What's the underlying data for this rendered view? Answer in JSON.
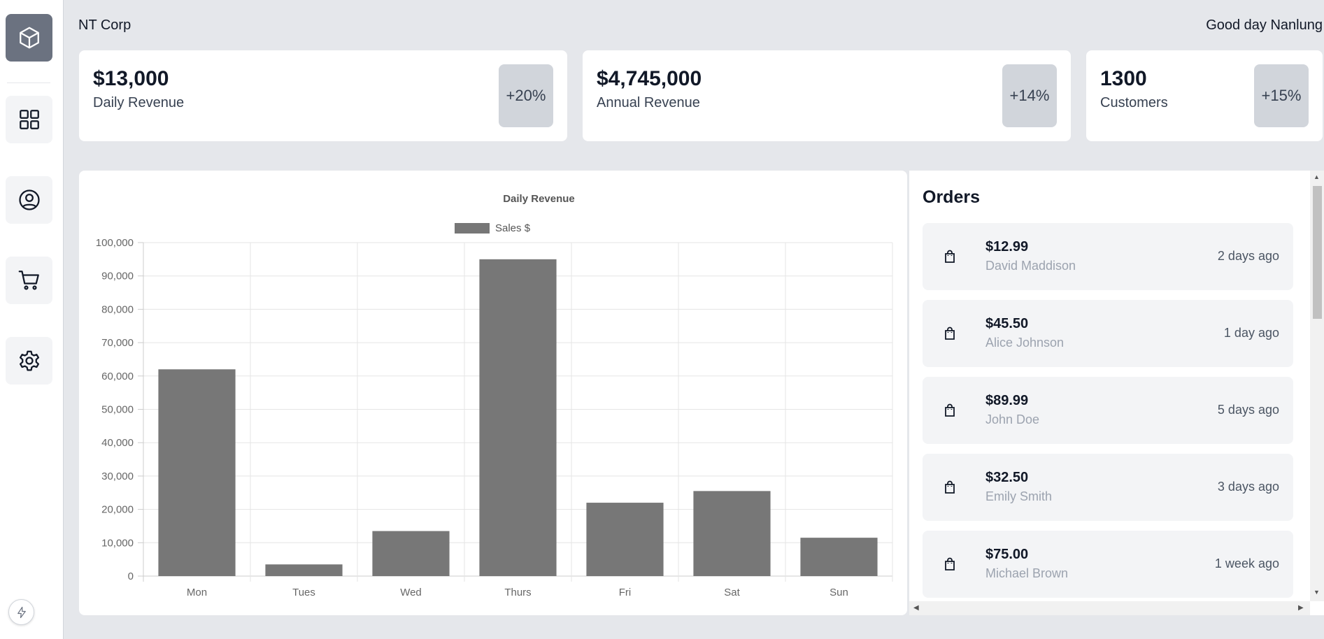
{
  "header": {
    "company": "NT Corp",
    "greeting": "Good day Nanlung"
  },
  "sidebar": {
    "items": [
      {
        "icon": "cube-icon"
      },
      {
        "icon": "dashboard-icon"
      },
      {
        "icon": "user-circle-icon"
      },
      {
        "icon": "cart-icon"
      },
      {
        "icon": "gear-icon"
      }
    ]
  },
  "stats": [
    {
      "value": "$13,000",
      "label": "Daily Revenue",
      "change": "+20%"
    },
    {
      "value": "$4,745,000",
      "label": "Annual Revenue",
      "change": "+14%"
    },
    {
      "value": "1300",
      "label": "Customers",
      "change": "+15%"
    }
  ],
  "orders": {
    "title": "Orders",
    "items": [
      {
        "amount": "$12.99",
        "name": "David Maddison",
        "time": "2 days ago"
      },
      {
        "amount": "$45.50",
        "name": "Alice Johnson",
        "time": "1 day ago"
      },
      {
        "amount": "$89.99",
        "name": "John Doe",
        "time": "5 days ago"
      },
      {
        "amount": "$32.50",
        "name": "Emily Smith",
        "time": "3 days ago"
      },
      {
        "amount": "$75.00",
        "name": "Michael Brown",
        "time": "1 week ago"
      }
    ]
  },
  "chart_data": {
    "type": "bar",
    "title": "Daily Revenue",
    "categories": [
      "Mon",
      "Tues",
      "Wed",
      "Thurs",
      "Fri",
      "Sat",
      "Sun"
    ],
    "series": [
      {
        "name": "Sales $",
        "values": [
          62000,
          3500,
          13500,
          95000,
          22000,
          25500,
          11500
        ]
      }
    ],
    "ylim": [
      0,
      100000
    ],
    "yticks": [
      "0",
      "10,000",
      "20,000",
      "30,000",
      "40,000",
      "50,000",
      "60,000",
      "70,000",
      "80,000",
      "90,000",
      "100,000"
    ],
    "grid": true,
    "legend": "top",
    "bar_color": "#777777"
  }
}
